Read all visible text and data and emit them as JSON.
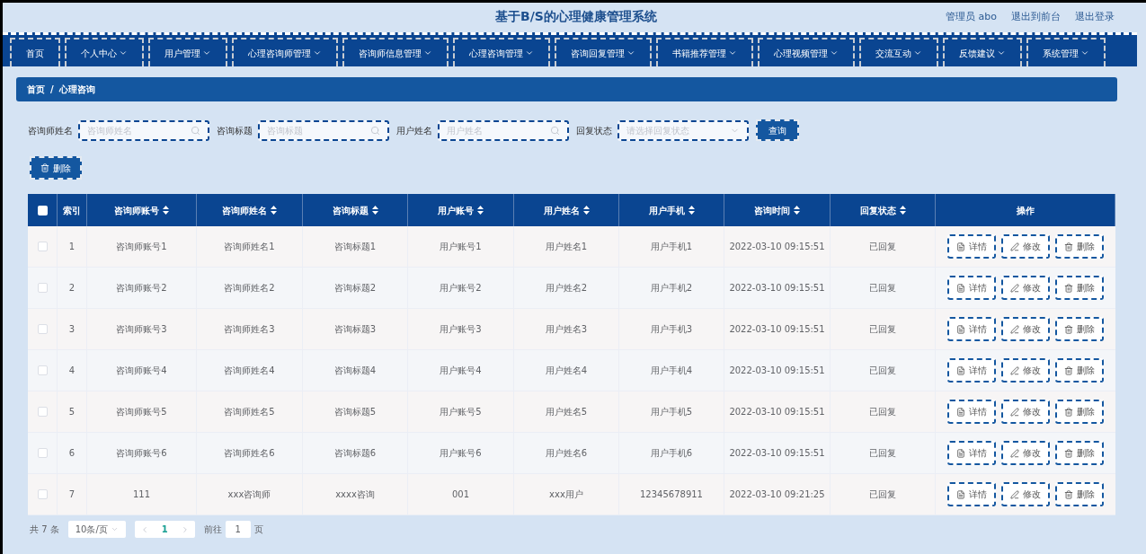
{
  "header": {
    "title": "基于B/S的心理健康管理系统",
    "links": [
      "管理员 abo",
      "退出到前台",
      "退出登录"
    ]
  },
  "nav": [
    {
      "label": "首页",
      "dropdown": false
    },
    {
      "label": "个人中心",
      "dropdown": true
    },
    {
      "label": "用户管理",
      "dropdown": true
    },
    {
      "label": "心理咨询师管理",
      "dropdown": true
    },
    {
      "label": "咨询师信息管理",
      "dropdown": true
    },
    {
      "label": "心理咨询管理",
      "dropdown": true
    },
    {
      "label": "咨询回复管理",
      "dropdown": true
    },
    {
      "label": "书籍推荐管理",
      "dropdown": true
    },
    {
      "label": "心理视频管理",
      "dropdown": true
    },
    {
      "label": "交流互动",
      "dropdown": true
    },
    {
      "label": "反馈建议",
      "dropdown": true
    },
    {
      "label": "系统管理",
      "dropdown": true
    }
  ],
  "breadcrumb": [
    "首页",
    "心理咨询"
  ],
  "breadcrumb_separator": "/",
  "filters": [
    {
      "kind": "text",
      "label": "咨询师姓名",
      "placeholder": "咨询师姓名"
    },
    {
      "kind": "text",
      "label": "咨询标题",
      "placeholder": "咨询标题"
    },
    {
      "kind": "text",
      "label": "用户姓名",
      "placeholder": "用户姓名"
    },
    {
      "kind": "select",
      "label": "回复状态",
      "placeholder": "请选择回复状态"
    }
  ],
  "query_button": "查询",
  "delete_button": "删除",
  "table": {
    "select_all_checked": false,
    "columns": [
      {
        "label": "索引",
        "sortable": false
      },
      {
        "label": "咨询师账号",
        "sortable": true
      },
      {
        "label": "咨询师姓名",
        "sortable": true
      },
      {
        "label": "咨询标题",
        "sortable": true
      },
      {
        "label": "用户账号",
        "sortable": true
      },
      {
        "label": "用户姓名",
        "sortable": true
      },
      {
        "label": "用户手机",
        "sortable": true
      },
      {
        "label": "咨询时间",
        "sortable": true
      },
      {
        "label": "回复状态",
        "sortable": true
      },
      {
        "label": "操作",
        "sortable": false
      }
    ],
    "rows": [
      {
        "checked": false,
        "cells": [
          "1",
          "咨询师账号1",
          "咨询师姓名1",
          "咨询标题1",
          "用户账号1",
          "用户姓名1",
          "用户手机1",
          "2022-03-10 09:15:51",
          "已回复"
        ],
        "actions": [
          {
            "kind": "detail",
            "label": "详情"
          },
          {
            "kind": "edit",
            "label": "修改"
          },
          {
            "kind": "delete",
            "label": "删除"
          }
        ]
      },
      {
        "checked": false,
        "cells": [
          "2",
          "咨询师账号2",
          "咨询师姓名2",
          "咨询标题2",
          "用户账号2",
          "用户姓名2",
          "用户手机2",
          "2022-03-10 09:15:51",
          "已回复"
        ],
        "actions": [
          {
            "kind": "detail",
            "label": "详情"
          },
          {
            "kind": "edit",
            "label": "修改"
          },
          {
            "kind": "delete",
            "label": "删除"
          }
        ]
      },
      {
        "checked": false,
        "cells": [
          "3",
          "咨询师账号3",
          "咨询师姓名3",
          "咨询标题3",
          "用户账号3",
          "用户姓名3",
          "用户手机3",
          "2022-03-10 09:15:51",
          "已回复"
        ],
        "actions": [
          {
            "kind": "detail",
            "label": "详情"
          },
          {
            "kind": "edit",
            "label": "修改"
          },
          {
            "kind": "delete",
            "label": "删除"
          }
        ]
      },
      {
        "checked": false,
        "cells": [
          "4",
          "咨询师账号4",
          "咨询师姓名4",
          "咨询标题4",
          "用户账号4",
          "用户姓名4",
          "用户手机4",
          "2022-03-10 09:15:51",
          "已回复"
        ],
        "actions": [
          {
            "kind": "detail",
            "label": "详情"
          },
          {
            "kind": "edit",
            "label": "修改"
          },
          {
            "kind": "delete",
            "label": "删除"
          }
        ]
      },
      {
        "checked": false,
        "cells": [
          "5",
          "咨询师账号5",
          "咨询师姓名5",
          "咨询标题5",
          "用户账号5",
          "用户姓名5",
          "用户手机5",
          "2022-03-10 09:15:51",
          "已回复"
        ],
        "actions": [
          {
            "kind": "detail",
            "label": "详情"
          },
          {
            "kind": "edit",
            "label": "修改"
          },
          {
            "kind": "delete",
            "label": "删除"
          }
        ]
      },
      {
        "checked": false,
        "cells": [
          "6",
          "咨询师账号6",
          "咨询师姓名6",
          "咨询标题6",
          "用户账号6",
          "用户姓名6",
          "用户手机6",
          "2022-03-10 09:15:51",
          "已回复"
        ],
        "actions": [
          {
            "kind": "detail",
            "label": "详情"
          },
          {
            "kind": "edit",
            "label": "修改"
          },
          {
            "kind": "delete",
            "label": "删除"
          }
        ]
      },
      {
        "checked": false,
        "cells": [
          "7",
          "111",
          "xxx咨询师",
          "xxxx咨询",
          "001",
          "xxx用户",
          "12345678911",
          "2022-03-10 09:21:25",
          "已回复"
        ],
        "actions": [
          {
            "kind": "detail",
            "label": "详情"
          },
          {
            "kind": "edit",
            "label": "修改"
          },
          {
            "kind": "delete",
            "label": "删除"
          }
        ]
      }
    ]
  },
  "pagination": {
    "total": "共 7 条",
    "page_size": "10条/页",
    "pages": [
      {
        "label": "1",
        "selected": true
      }
    ],
    "goto_label": "前往",
    "goto_value": "1",
    "goto_suffix": "页"
  }
}
